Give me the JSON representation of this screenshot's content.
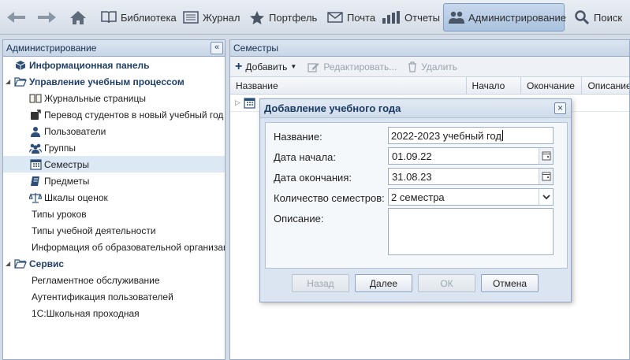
{
  "toolbar": {
    "library": "Библиотека",
    "journal": "Журнал",
    "portfolio": "Портфель",
    "mail": "Почта",
    "reports": "Отчеты",
    "admin": "Администрирование",
    "search": "Поиск"
  },
  "left": {
    "title": "Администрирование",
    "items": [
      "Информационная панель",
      "Управление учебным процессом",
      "Журнальные страницы",
      "Перевод студентов в новый учебный год",
      "Пользователи",
      "Группы",
      "Семестры",
      "Предметы",
      "Шкалы оценок",
      "Типы уроков",
      "Типы учебной деятельности",
      "Информация об образовательной организации",
      "Сервис",
      "Регламентное обслуживание",
      "Аутентификация пользователей",
      "1С:Школьная проходная"
    ]
  },
  "right": {
    "title": "Семестры",
    "add": "Добавить",
    "edit": "Редактировать...",
    "delete": "Удалить",
    "columns": [
      "Название",
      "Начало",
      "Окончание",
      "Описание"
    ]
  },
  "dialog": {
    "title": "Добавление учебного года",
    "fields": {
      "name_label": "Название:",
      "name_value": "2022-2023 учебный год",
      "start_label": "Дата начала:",
      "start_value": "01.09.22",
      "end_label": "Дата окончания:",
      "end_value": "31.08.23",
      "count_label": "Количество семестров:",
      "count_value": "2 семестра",
      "desc_label": "Описание:"
    },
    "buttons": {
      "back": "Назад",
      "next": "Далее",
      "ok": "ОК",
      "cancel": "Отмена"
    }
  },
  "colors": {
    "accent": "#1f3f6b",
    "selected": "#dde8f5",
    "active_tab": "#a9c2de"
  }
}
